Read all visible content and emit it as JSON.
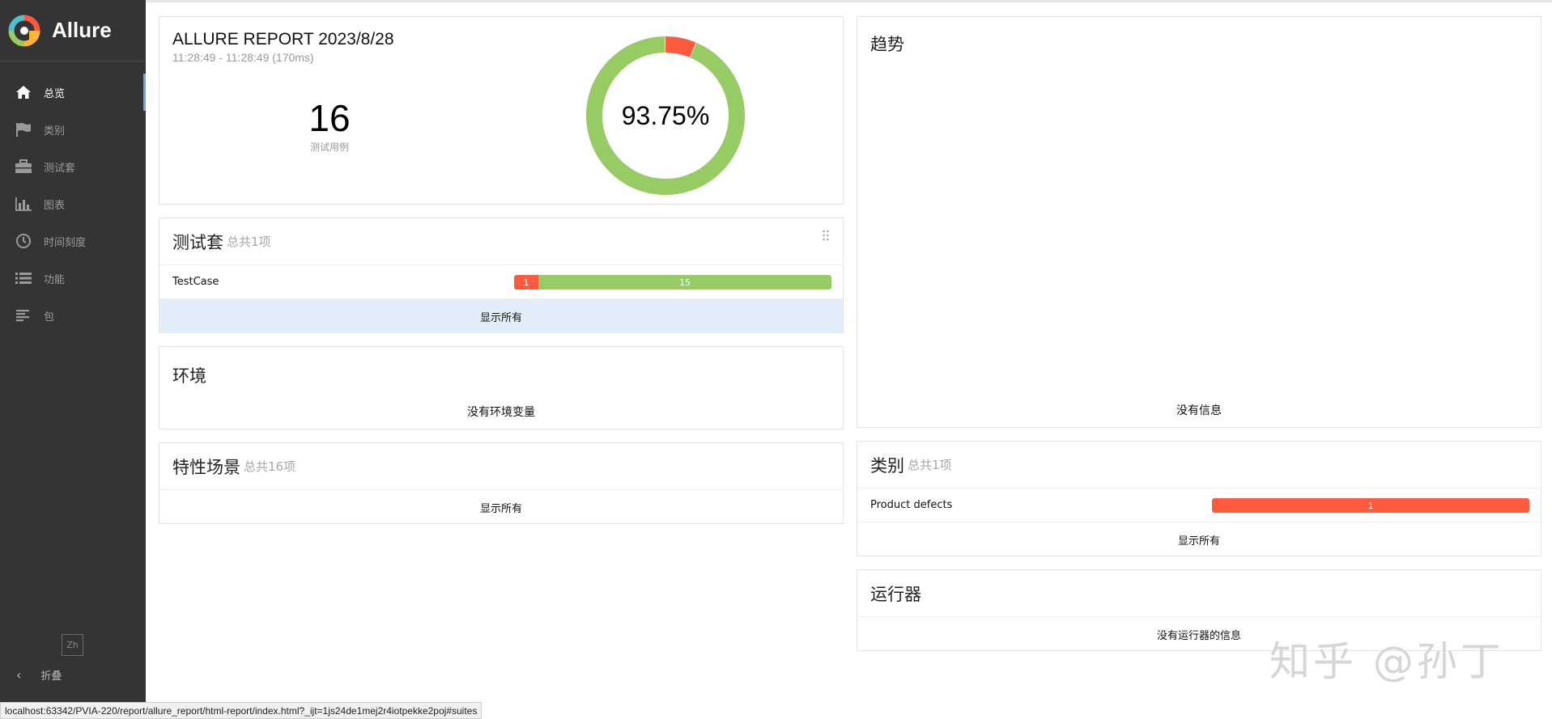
{
  "app": {
    "name": "Allure"
  },
  "sidebar": {
    "items": [
      {
        "label": "总览",
        "icon": "home-icon"
      },
      {
        "label": "类别",
        "icon": "flag-icon"
      },
      {
        "label": "测试套",
        "icon": "briefcase-icon"
      },
      {
        "label": "图表",
        "icon": "bar-chart-icon"
      },
      {
        "label": "时间刻度",
        "icon": "clock-icon"
      },
      {
        "label": "功能",
        "icon": "list-icon"
      },
      {
        "label": "包",
        "icon": "align-left-icon"
      }
    ],
    "language": "Zh",
    "collapse_label": "折叠"
  },
  "summary": {
    "title": "ALLURE REPORT 2023/8/28",
    "time": "11:28:49 - 11:28:49 (170ms)",
    "count": "16",
    "count_label": "测试用例",
    "percent": "93.75%",
    "passed": 15,
    "failed": 1,
    "colors": {
      "passed": "#97cc64",
      "failed": "#fd5a3e"
    }
  },
  "suites": {
    "title": "测试套",
    "subtitle": "总共1项",
    "rows": [
      {
        "name": "TestCase",
        "failed": "1",
        "passed": "15"
      }
    ],
    "show_all": "显示所有"
  },
  "environment": {
    "title": "环境",
    "message": "没有环境变量"
  },
  "features": {
    "title": "特性场景",
    "subtitle": "总共16项",
    "show_all": "显示所有"
  },
  "trend": {
    "title": "趋势",
    "message": "没有信息"
  },
  "categories": {
    "title": "类别",
    "subtitle": "总共1项",
    "rows": [
      {
        "name": "Product defects",
        "failed": "1"
      }
    ],
    "show_all": "显示所有"
  },
  "executors": {
    "title": "运行器",
    "message": "没有运行器的信息"
  },
  "watermark": "知乎 @孙丁",
  "status_url": "localhost:63342/PVIA-220/report/allure_report/html-report/index.html?_ijt=1js24de1mej2r4iotpekke2poj#suites"
}
